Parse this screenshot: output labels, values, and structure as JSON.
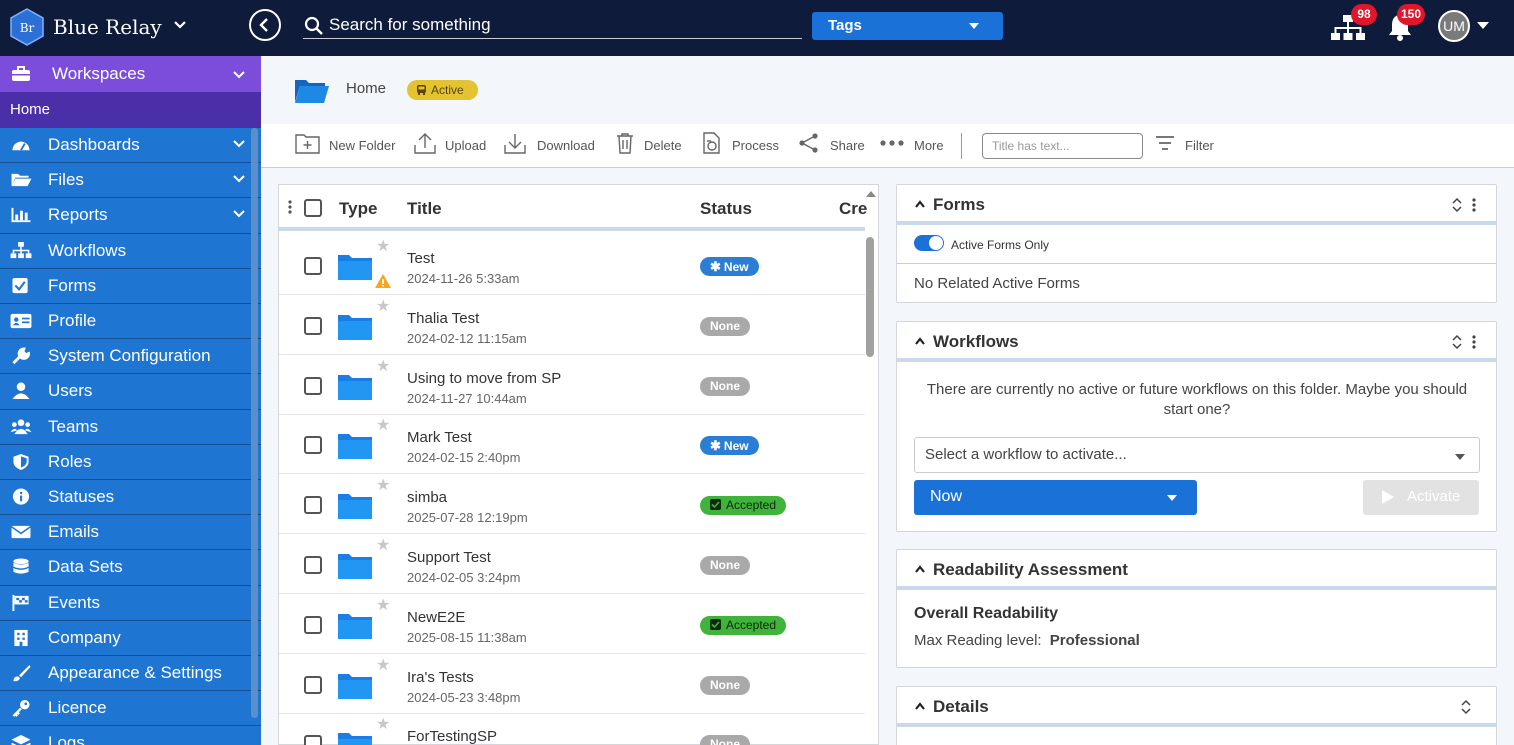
{
  "app": {
    "brand": "Blue Relay",
    "logo_text": "Br"
  },
  "topbar": {
    "search_placeholder": "Search for something",
    "tags_label": "Tags",
    "org_badge": "98",
    "notif_badge": "150",
    "avatar_initials": "UM"
  },
  "sidebar": {
    "workspaces_label": "Workspaces",
    "home_label": "Home",
    "items": [
      {
        "label": "Dashboards",
        "icon": "gauge-icon",
        "chevron": true
      },
      {
        "label": "Files",
        "icon": "folder-open-icon",
        "chevron": true
      },
      {
        "label": "Reports",
        "icon": "bar-chart-icon",
        "chevron": true
      },
      {
        "label": "Workflows",
        "icon": "sitemap-icon",
        "chevron": false
      },
      {
        "label": "Forms",
        "icon": "checkbox-icon",
        "chevron": false
      },
      {
        "label": "Profile",
        "icon": "id-card-icon",
        "chevron": false
      },
      {
        "label": "System Configuration",
        "icon": "wrench-icon",
        "chevron": false
      },
      {
        "label": "Users",
        "icon": "user-icon",
        "chevron": false
      },
      {
        "label": "Teams",
        "icon": "users-icon",
        "chevron": false
      },
      {
        "label": "Roles",
        "icon": "shield-icon",
        "chevron": false
      },
      {
        "label": "Statuses",
        "icon": "info-icon",
        "chevron": false
      },
      {
        "label": "Emails",
        "icon": "envelope-icon",
        "chevron": false
      },
      {
        "label": "Data Sets",
        "icon": "database-icon",
        "chevron": false
      },
      {
        "label": "Events",
        "icon": "flag-icon",
        "chevron": false
      },
      {
        "label": "Company",
        "icon": "building-icon",
        "chevron": false
      },
      {
        "label": "Appearance & Settings",
        "icon": "paint-brush-icon",
        "chevron": false
      },
      {
        "label": "Licence",
        "icon": "key-icon",
        "chevron": false
      },
      {
        "label": "Logs",
        "icon": "layers-icon",
        "chevron": false
      }
    ]
  },
  "breadcrumb": {
    "title": "Home",
    "status": "Active"
  },
  "toolbar": {
    "new_folder": "New Folder",
    "upload": "Upload",
    "download": "Download",
    "delete": "Delete",
    "process": "Process",
    "share": "Share",
    "more": "More",
    "filter_placeholder": "Title has text...",
    "filter": "Filter"
  },
  "file_table": {
    "columns": {
      "type": "Type",
      "title": "Title",
      "status": "Status",
      "created": "Cre"
    },
    "rows": [
      {
        "title": "Test",
        "date": "2024-11-26 5:33am",
        "status": "New",
        "kind": "new",
        "warning": true
      },
      {
        "title": "Thalia Test",
        "date": "2024-02-12 11:15am",
        "status": "None",
        "kind": "none",
        "warning": false
      },
      {
        "title": "Using to move from SP",
        "date": "2024-11-27 10:44am",
        "status": "None",
        "kind": "none",
        "warning": false
      },
      {
        "title": "Mark Test",
        "date": "2024-02-15 2:40pm",
        "status": "New",
        "kind": "new",
        "warning": false
      },
      {
        "title": "simba",
        "date": "2025-07-28 12:19pm",
        "status": "Accepted",
        "kind": "acc",
        "warning": false
      },
      {
        "title": "Support Test",
        "date": "2024-02-05 3:24pm",
        "status": "None",
        "kind": "none",
        "warning": false
      },
      {
        "title": "NewE2E",
        "date": "2025-08-15 11:38am",
        "status": "Accepted",
        "kind": "acc",
        "warning": false
      },
      {
        "title": "Ira's Tests",
        "date": "2024-05-23 3:48pm",
        "status": "None",
        "kind": "none",
        "warning": false
      },
      {
        "title": "ForTestingSP",
        "date": "",
        "status": "None",
        "kind": "none",
        "warning": false
      }
    ]
  },
  "forms_card": {
    "title": "Forms",
    "toggle_label": "Active Forms Only",
    "empty": "No Related Active Forms"
  },
  "workflows_card": {
    "title": "Workflows",
    "message": "There are currently no active or future workflows on this folder. Maybe you should start one?",
    "select_placeholder": "Select a workflow to activate...",
    "now_label": "Now",
    "activate_label": "Activate"
  },
  "readability_card": {
    "title": "Readability Assessment",
    "heading": "Overall Readability",
    "label": "Max Reading level:",
    "value": "Professional"
  },
  "details_card": {
    "title": "Details"
  },
  "colors": {
    "topbar": "#0e1b3a",
    "sidebar": "#1f76d2",
    "workspaces": "#7c4ddb",
    "accent": "#1a72d9",
    "active_badge": "#e3c332"
  }
}
